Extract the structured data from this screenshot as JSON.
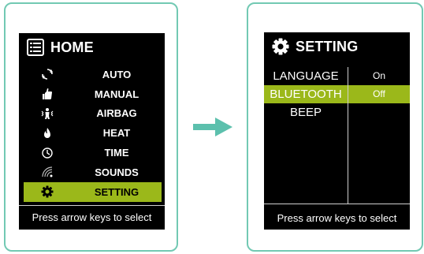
{
  "home": {
    "title": "HOME",
    "items": [
      {
        "label": "AUTO",
        "icon": "auto-cycle-icon"
      },
      {
        "label": "MANUAL",
        "icon": "hand-icon"
      },
      {
        "label": "AIRBAG",
        "icon": "airbag-person-icon"
      },
      {
        "label": "HEAT",
        "icon": "flame-icon"
      },
      {
        "label": "TIME",
        "icon": "clock-icon"
      },
      {
        "label": "SOUNDS",
        "icon": "sound-icon"
      },
      {
        "label": "SETTING",
        "icon": "gear-icon"
      }
    ],
    "selected_index": 6,
    "footer": "Press arrow keys to select"
  },
  "setting": {
    "title": "SETTING",
    "items": [
      "LANGUAGE",
      "BLUETOOTH",
      "BEEP"
    ],
    "selected_index": 1,
    "options": [
      "On",
      "Off"
    ],
    "selected_option_index": 1,
    "footer": "Press arrow keys to select"
  },
  "colors": {
    "border": "#72c9b3",
    "highlight": "#9bb81a",
    "screen_bg": "#000000",
    "arrow": "#5cc0ad"
  }
}
